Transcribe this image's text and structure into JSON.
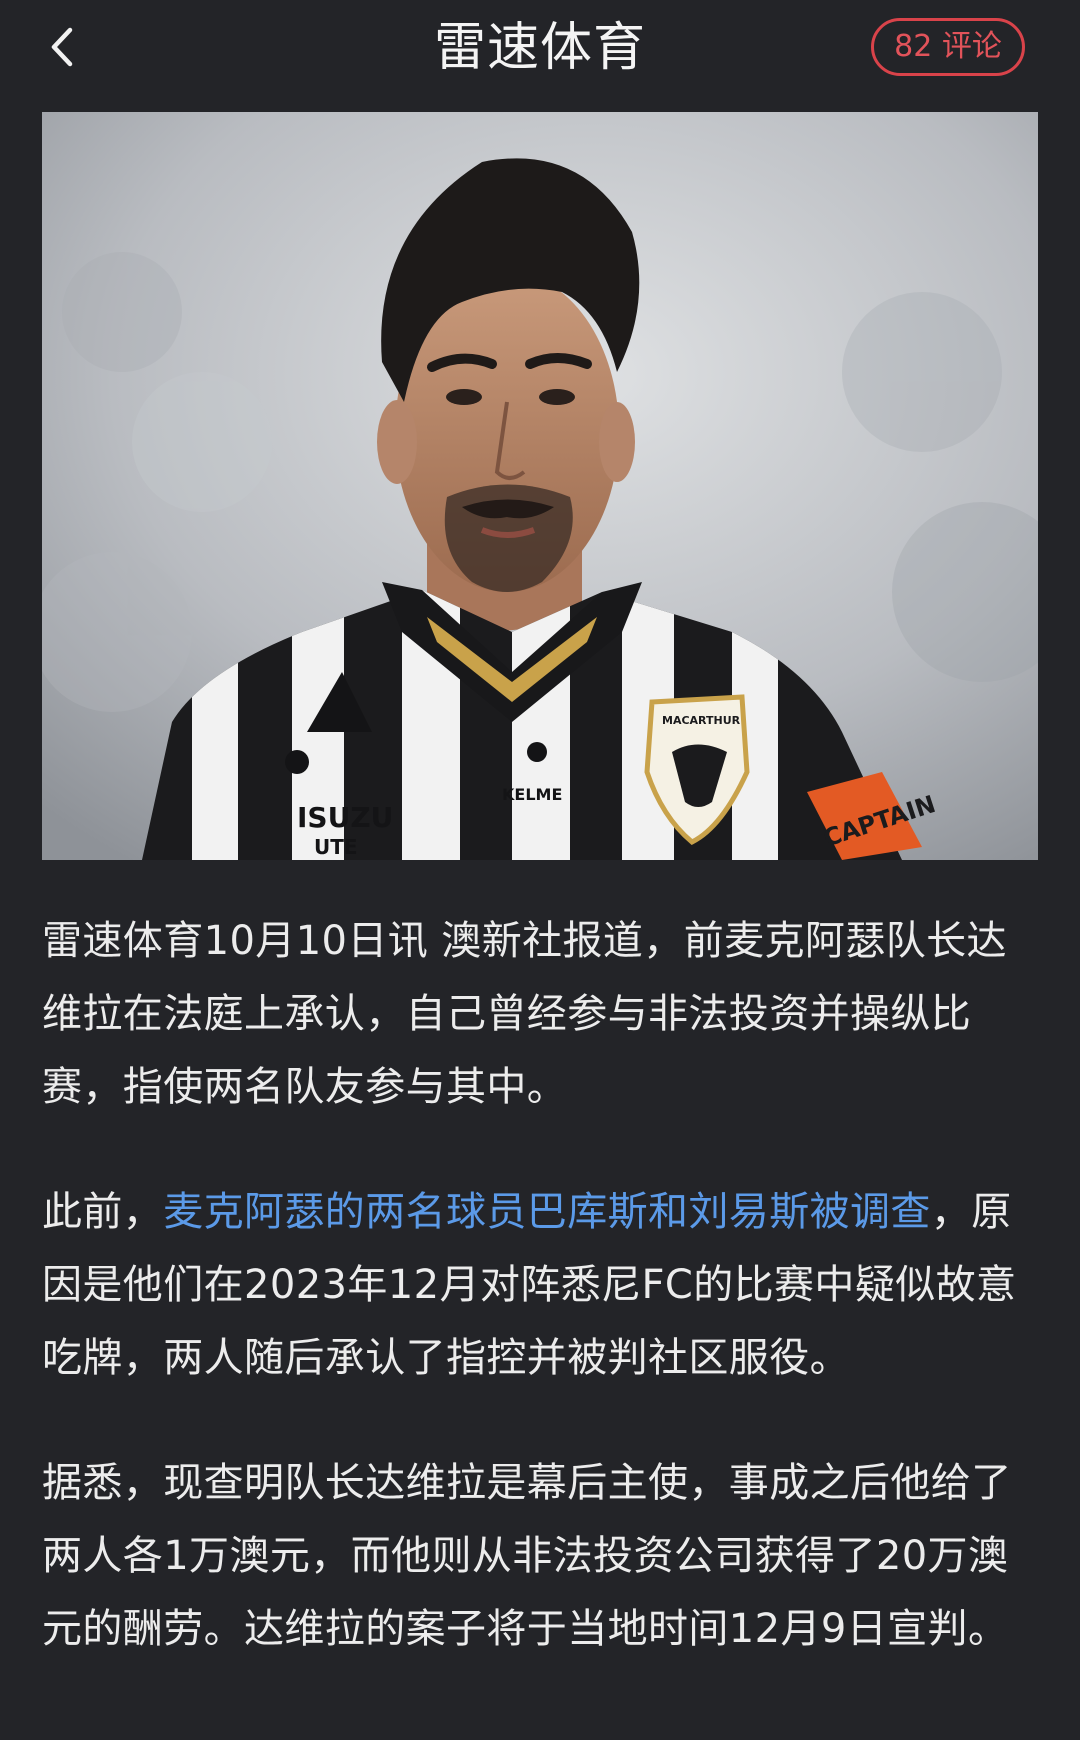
{
  "header": {
    "title": "雷速体育",
    "comments_label": "82 评论"
  },
  "image": {
    "jersey_sponsor_1": "ISUZU",
    "jersey_sponsor_2": "UTE",
    "kit_brand": "KELME",
    "club_badge": "MACARTHUR",
    "armband": "CAPTAIN"
  },
  "article": {
    "p1": "雷速体育10月10日讯 澳新社报道，前麦克阿瑟队长达维拉在法庭上承认，自己曾经参与非法投资并操纵比赛，指使两名队友参与其中。",
    "p2_before": "此前，",
    "p2_link": "麦克阿瑟的两名球员巴库斯和刘易斯被调查",
    "p2_after": "，原因是他们在2023年12月对阵悉尼FC的比赛中疑似故意吃牌，两人随后承认了指控并被判社区服役。",
    "p3": "据悉，现查明队长达维拉是幕后主使，事成之后他给了两人各1万澳元，而他则从非法投资公司获得了20万澳元的酬劳。达维拉的案子将于当地时间12月9日宣判。"
  },
  "colors": {
    "background": "#232428",
    "accent_red": "#d9434a",
    "link_blue": "#5b9ae8"
  }
}
